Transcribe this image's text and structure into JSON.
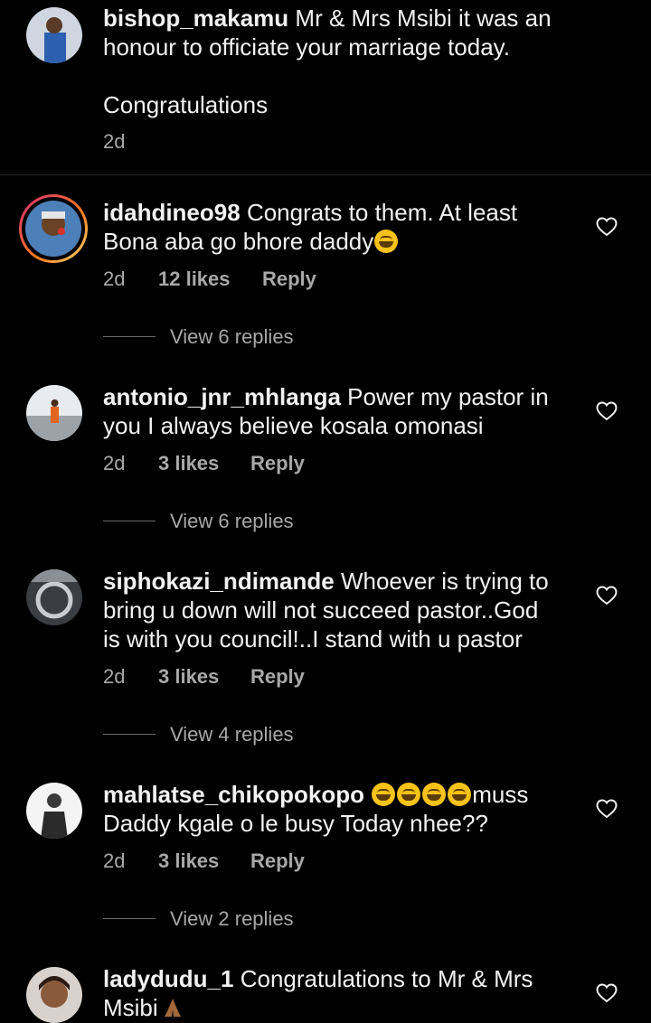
{
  "comments": [
    {
      "username": "bishop_makamu",
      "text_line1": "Mr & Mrs Msibi it was an",
      "text_line2": "honour to officiate your marriage today.",
      "text_line3": "Congratulations",
      "time": "2d"
    },
    {
      "username": "idahdineo98",
      "text_line1": "Congrats to them. At least",
      "text_line2": "Bona aba go bhore daddy",
      "emoji": "yawning-face-emoji",
      "time": "2d",
      "likes": "12 likes",
      "reply": "Reply",
      "view_replies": "View 6 replies"
    },
    {
      "username": "antonio_jnr_mhlanga",
      "text_line1": "Power my pastor in",
      "text_line2": "you I always believe kosala omonasi",
      "time": "2d",
      "likes": "3 likes",
      "reply": "Reply",
      "view_replies": "View 6 replies"
    },
    {
      "username": "siphokazi_ndimande",
      "text_line1": "Whoever is trying to",
      "text_line2": "bring u down will not succeed pastor..God",
      "text_line3": "is with you council!..I stand with u pastor",
      "time": "2d",
      "likes": "3 likes",
      "reply": "Reply",
      "view_replies": "View 4 replies"
    },
    {
      "username": "mahlatse_chikopokopo",
      "text_line1_after_emoji": "muss",
      "emoji": "grinning-squinting-face-emoji",
      "text_line2": "Daddy kgale o le busy Today nhee??",
      "time": "2d",
      "likes": "3 likes",
      "reply": "Reply",
      "view_replies": "View 2 replies"
    },
    {
      "username": "ladydudu_1",
      "text_line1": "Congratulations to Mr & Mrs",
      "text_line2": "Msibi",
      "emoji": "folded-hands-emoji"
    }
  ],
  "colors": {
    "background": "#000000",
    "text": "#f2f2f2",
    "meta": "#a8a8a8",
    "divider": "#262626"
  }
}
